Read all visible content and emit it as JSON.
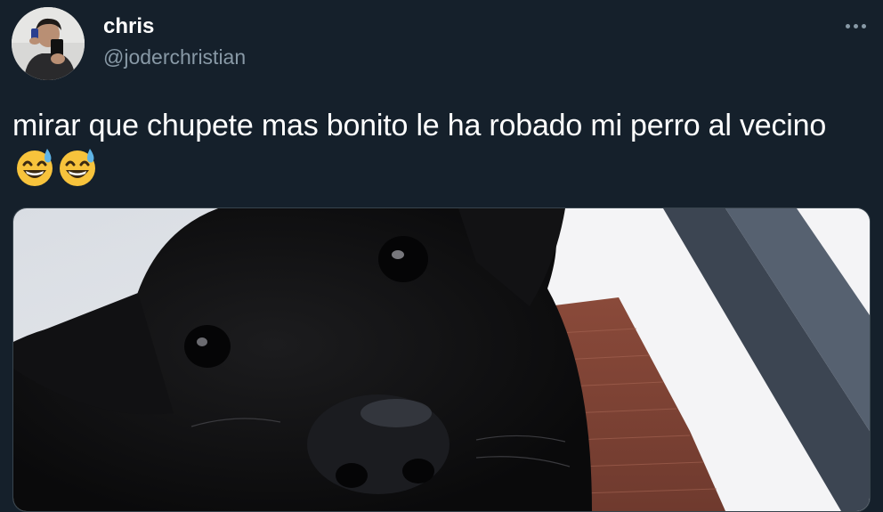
{
  "tweet": {
    "author": {
      "display_name": "chris",
      "handle": "@joderchristian"
    },
    "text": "mirar que chupete mas bonito le ha robado mi perro al vecino",
    "emojis": [
      "grinning-sweat-emoji",
      "grinning-sweat-emoji"
    ],
    "media": {
      "icon": "dog-photo"
    }
  },
  "colors": {
    "background": "#15202b",
    "text_primary": "#ffffff",
    "text_secondary": "#8899a6",
    "border": "#38444d"
  },
  "icons": {
    "more": "more-horizontal-icon"
  }
}
